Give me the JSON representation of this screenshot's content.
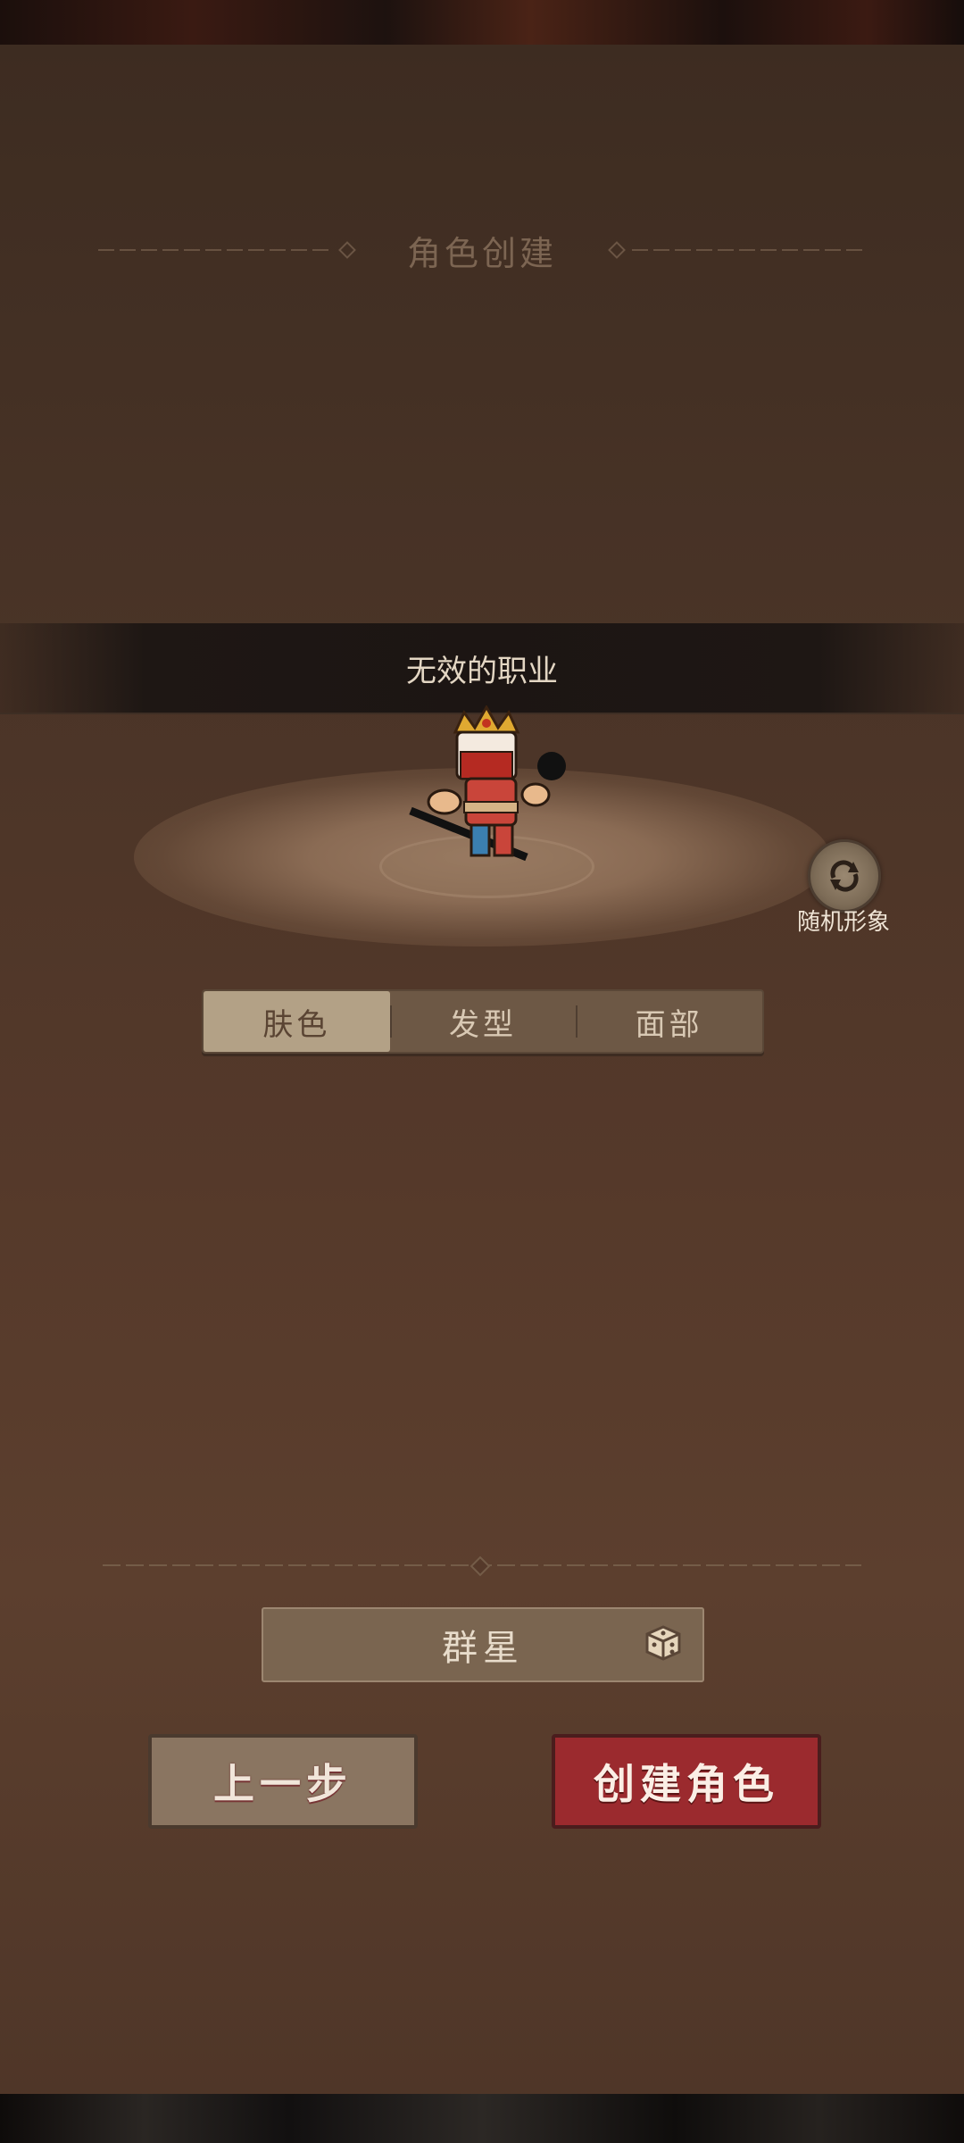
{
  "header": {
    "title": "角色创建"
  },
  "character": {
    "class_name": "无效的职业"
  },
  "random_appearance": {
    "label": "随机形象",
    "icon": "refresh-icon"
  },
  "tabs": [
    {
      "label": "肤色",
      "active": true
    },
    {
      "label": "发型",
      "active": false
    },
    {
      "label": "面部",
      "active": false
    }
  ],
  "name_field": {
    "value": "群星",
    "icon": "dice-icon"
  },
  "buttons": {
    "prev": "上一步",
    "create": "创建角色"
  },
  "colors": {
    "panel": "#4a3427",
    "create_button": "#9b2a2e",
    "active_tab": "#b3a186"
  }
}
